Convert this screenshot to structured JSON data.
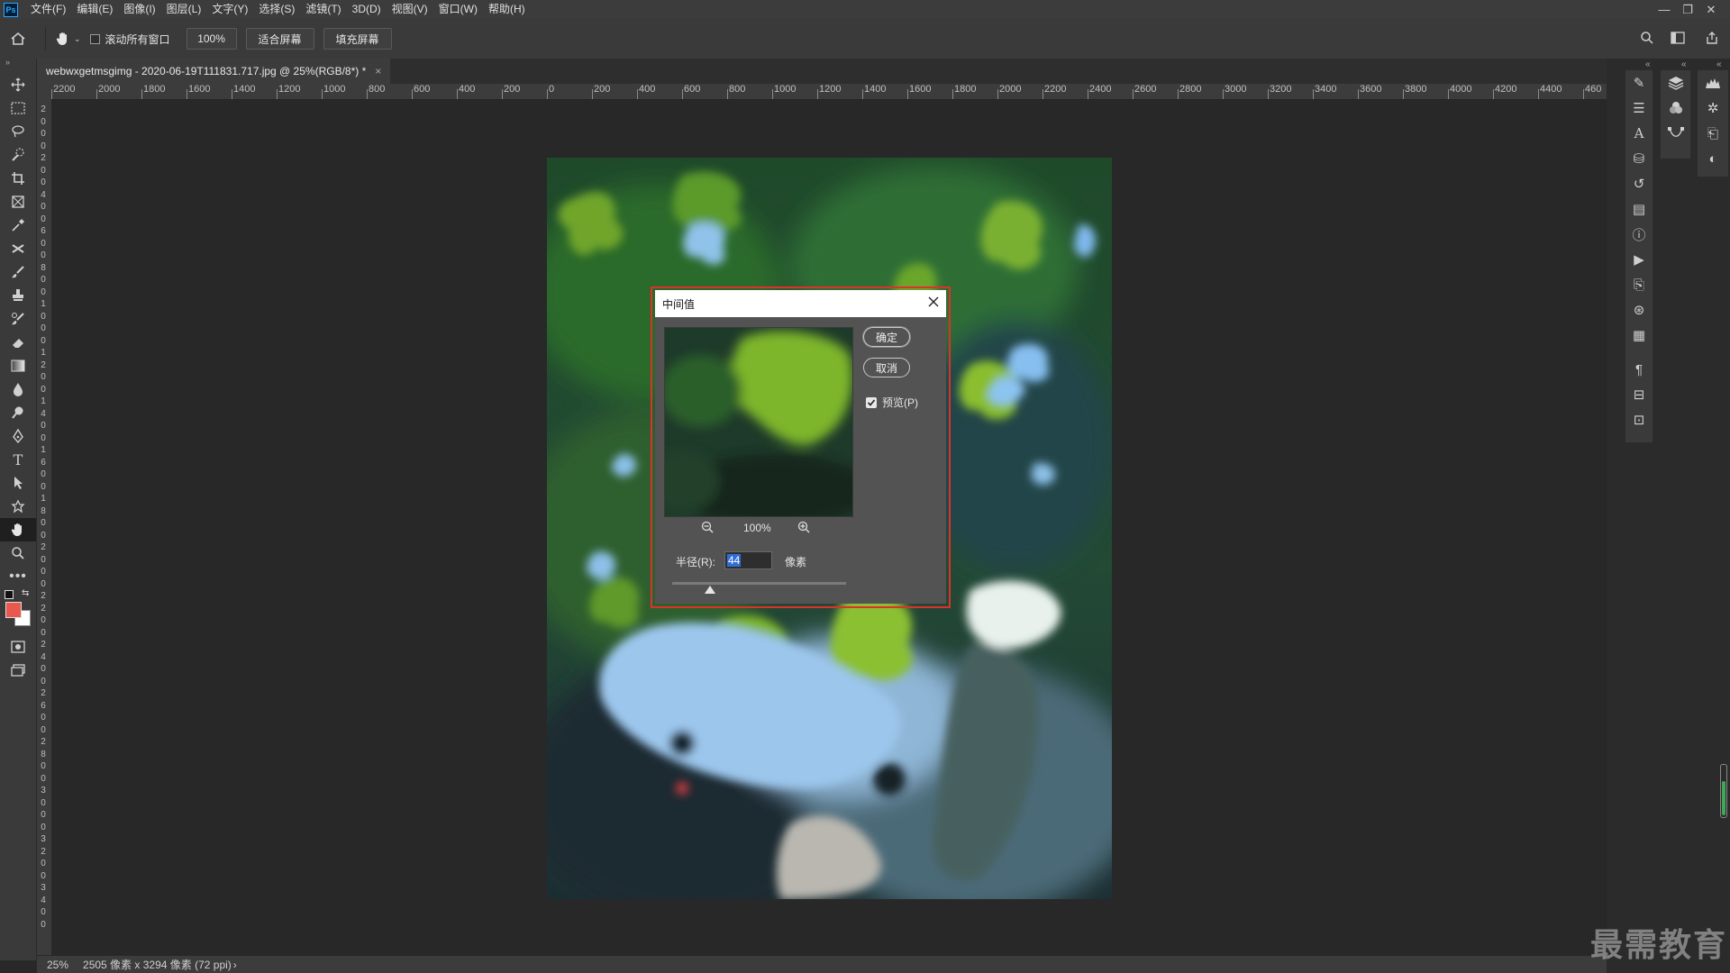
{
  "menubar": {
    "logo": "Ps",
    "items": [
      "文件(F)",
      "编辑(E)",
      "图像(I)",
      "图层(L)",
      "文字(Y)",
      "选择(S)",
      "滤镜(T)",
      "3D(D)",
      "视图(V)",
      "窗口(W)",
      "帮助(H)"
    ],
    "window_controls": [
      "—",
      "❐",
      "✕"
    ]
  },
  "options": {
    "scroll_all_label": "滚动所有窗口",
    "zoom_value": "100%",
    "fit_screen_label": "适合屏幕",
    "fill_screen_label": "填充屏幕"
  },
  "document": {
    "tab_title": "webwxgetmsgimg - 2020-06-19T111831.717.jpg @ 25%(RGB/8*) *",
    "tab_close": "×"
  },
  "ruler_h": [
    "2200",
    "2000",
    "1800",
    "1600",
    "1400",
    "1200",
    "1000",
    "800",
    "600",
    "400",
    "200",
    "0",
    "200",
    "400",
    "600",
    "800",
    "1000",
    "1200",
    "1400",
    "1600",
    "1800",
    "2000",
    "2200",
    "2400",
    "2600",
    "2800",
    "3000",
    "3200",
    "3400",
    "3600",
    "3800",
    "4000",
    "4200",
    "4400",
    "460"
  ],
  "ruler_v": [
    "2",
    "0",
    "0",
    "0",
    "2",
    "0",
    "0",
    "4",
    "0",
    "0",
    "6",
    "0",
    "0",
    "8",
    "0",
    "0",
    "1",
    "0",
    "0",
    "0",
    "1",
    "2",
    "0",
    "0",
    "1",
    "4",
    "0",
    "0",
    "1",
    "6",
    "0",
    "0",
    "1",
    "8",
    "0",
    "0",
    "2",
    "0",
    "0",
    "0",
    "2",
    "2",
    "0",
    "0",
    "2",
    "4",
    "0",
    "0",
    "2",
    "6",
    "0",
    "0",
    "2",
    "8",
    "0",
    "0",
    "3",
    "0",
    "0",
    "0",
    "3",
    "2",
    "0",
    "0",
    "3",
    "4",
    "0",
    "0"
  ],
  "status": {
    "zoom": "25%",
    "doc_info": "2505 像素 x 3294 像素 (72 ppi)",
    "arrow": "›"
  },
  "dialog": {
    "title": "中间值",
    "ok_label": "确定",
    "cancel_label": "取消",
    "preview_label": "预览(P)",
    "preview_checked": true,
    "zoom_value": "100%",
    "radius_label": "半径(R):",
    "radius_value": "44",
    "unit_label": "像素"
  },
  "watermark": "最需教育",
  "colors": {
    "foreground": "#e8584e",
    "background": "#ffffff",
    "highlight": "#e0302b"
  }
}
